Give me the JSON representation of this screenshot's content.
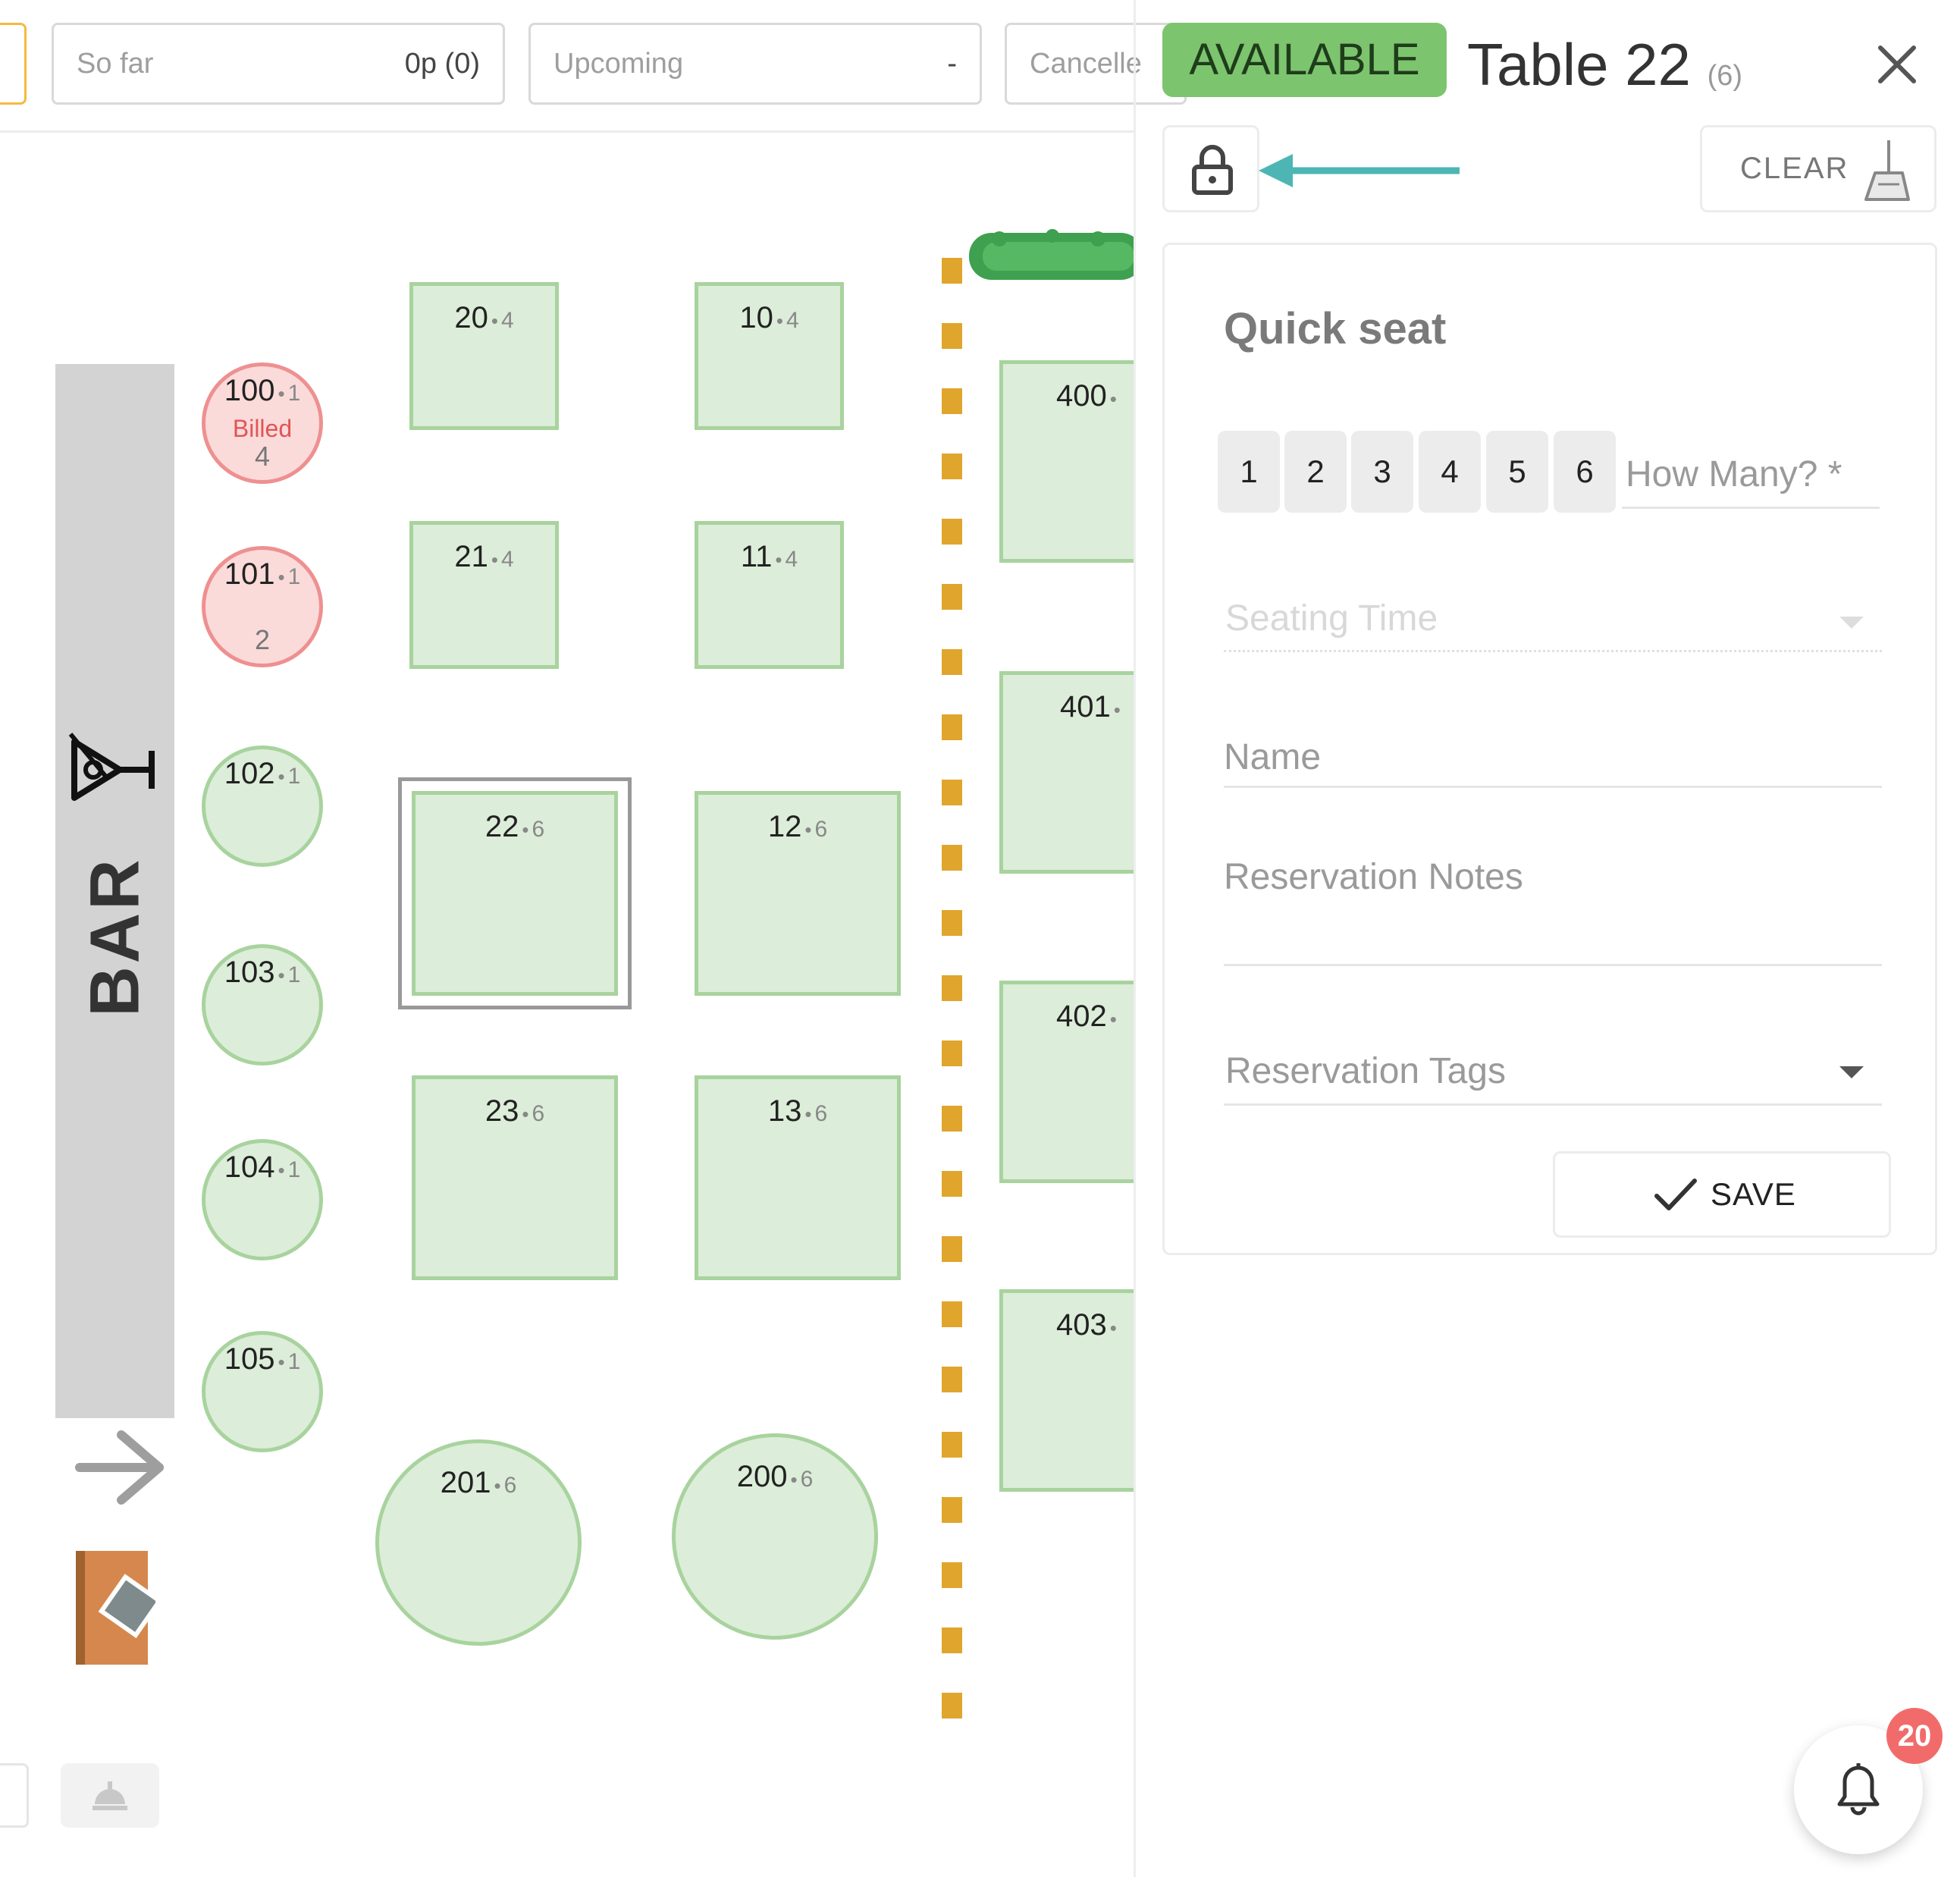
{
  "filters": {
    "so_far_label": "So far",
    "so_far_value": "0p (0)",
    "upcoming_label": "Upcoming",
    "upcoming_value": "-",
    "cancelled_label": "Cancelle"
  },
  "floor": {
    "bar_label": "BAR",
    "tables": [
      {
        "id": "100",
        "capacity": "1",
        "status": "Billed",
        "guests": "4"
      },
      {
        "id": "101",
        "capacity": "1",
        "guests": "2"
      },
      {
        "id": "102",
        "capacity": "1"
      },
      {
        "id": "103",
        "capacity": "1"
      },
      {
        "id": "104",
        "capacity": "1"
      },
      {
        "id": "105",
        "capacity": "1"
      },
      {
        "id": "20",
        "capacity": "4"
      },
      {
        "id": "10",
        "capacity": "4"
      },
      {
        "id": "21",
        "capacity": "4"
      },
      {
        "id": "11",
        "capacity": "4"
      },
      {
        "id": "22",
        "capacity": "6"
      },
      {
        "id": "12",
        "capacity": "6"
      },
      {
        "id": "23",
        "capacity": "6"
      },
      {
        "id": "13",
        "capacity": "6"
      },
      {
        "id": "201",
        "capacity": "6"
      },
      {
        "id": "200",
        "capacity": "6"
      },
      {
        "id": "400",
        "capacity": ""
      },
      {
        "id": "401",
        "capacity": ""
      },
      {
        "id": "402",
        "capacity": ""
      },
      {
        "id": "403",
        "capacity": ""
      }
    ]
  },
  "panel": {
    "status": "AVAILABLE",
    "title": "Table 22",
    "capacity": "(6)",
    "clear_label": "CLEAR",
    "quick_seat_title": "Quick seat",
    "party_sizes": [
      "1",
      "2",
      "3",
      "4",
      "5",
      "6"
    ],
    "how_many_placeholder": "How Many? *",
    "seating_time_placeholder": "Seating Time",
    "name_placeholder": "Name",
    "notes_placeholder": "Reservation Notes",
    "tags_placeholder": "Reservation Tags",
    "save_label": "SAVE"
  },
  "notifications": {
    "count": "20"
  },
  "colors": {
    "available": "#7dc46f",
    "table_fill": "#dcedd9",
    "table_border": "#a8d39e",
    "billed_fill": "#fbdada",
    "billed_border": "#ee9090",
    "fence": "#e0a52c",
    "teal_arrow": "#4db6b4",
    "badge": "#f26b6b"
  }
}
